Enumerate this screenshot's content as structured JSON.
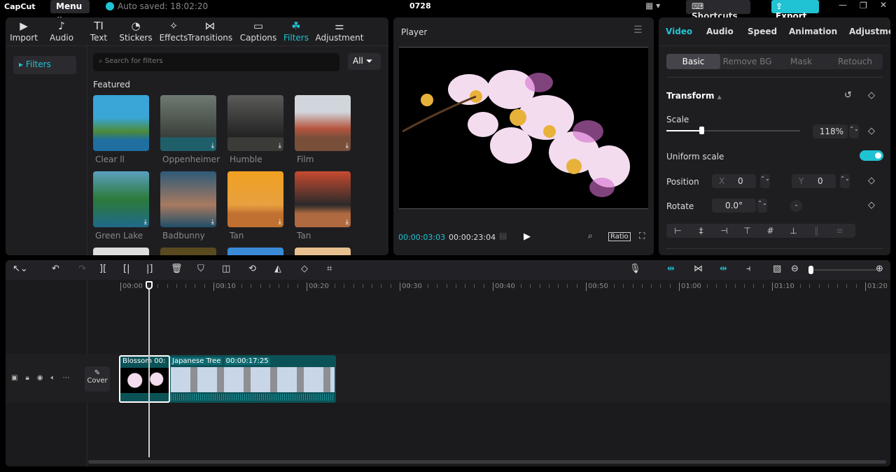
{
  "app": {
    "logo": "CapCut",
    "menu": "Menu",
    "autosave": "Auto saved: 18:02:20",
    "project": "0728",
    "shortcuts": "Shortcuts",
    "export": "Export",
    "accent": "#1fc3d3"
  },
  "toolbar": [
    {
      "label": "Import",
      "icon": "▶"
    },
    {
      "label": "Audio",
      "icon": "♪"
    },
    {
      "label": "Text",
      "icon": "TI"
    },
    {
      "label": "Stickers",
      "icon": "◔"
    },
    {
      "label": "Effects",
      "icon": "✧"
    },
    {
      "label": "Transitions",
      "icon": "⋈"
    },
    {
      "label": "Captions",
      "icon": "▭"
    },
    {
      "label": "Filters",
      "icon": "☘"
    },
    {
      "label": "Adjustment",
      "icon": "⚌"
    }
  ],
  "filters": {
    "sidebar": "Filters",
    "search_placeholder": "Search for filters",
    "all": "All",
    "section": "Featured",
    "items": [
      {
        "name": "Clear ll"
      },
      {
        "name": "Oppenheimer"
      },
      {
        "name": "Humble"
      },
      {
        "name": "Film"
      },
      {
        "name": "Green Lake"
      },
      {
        "name": "Badbunny"
      },
      {
        "name": "Tan"
      },
      {
        "name": "Tan"
      }
    ]
  },
  "player": {
    "title": "Player",
    "current": "00:00:03:03",
    "total": "00:00:23:04",
    "ratio": "Ratio"
  },
  "inspector": {
    "tabs": [
      "Video",
      "Audio",
      "Speed",
      "Animation",
      "Adjustment"
    ],
    "subtabs": [
      "Basic",
      "Remove BG",
      "Mask",
      "Retouch"
    ],
    "section": "Transform",
    "scale_label": "Scale",
    "scale": "118%",
    "scale_fraction": 0.26,
    "uniform": "Uniform scale",
    "uniform_on": true,
    "position_label": "Position",
    "x_label": "X",
    "x": "0",
    "y_label": "Y",
    "y": "0",
    "rotate_label": "Rotate",
    "rotate": "0.0°"
  },
  "timeline": {
    "ruler": [
      "00:00",
      "00:10",
      "00:20",
      "00:30",
      "00:40",
      "00:50",
      "01:00",
      "01:10",
      "01:20"
    ],
    "cover": "Cover",
    "clips": [
      {
        "name": "Blossom",
        "dur": "00:"
      },
      {
        "name": "Japanese Tree",
        "dur": "00:00:17:25"
      }
    ]
  }
}
